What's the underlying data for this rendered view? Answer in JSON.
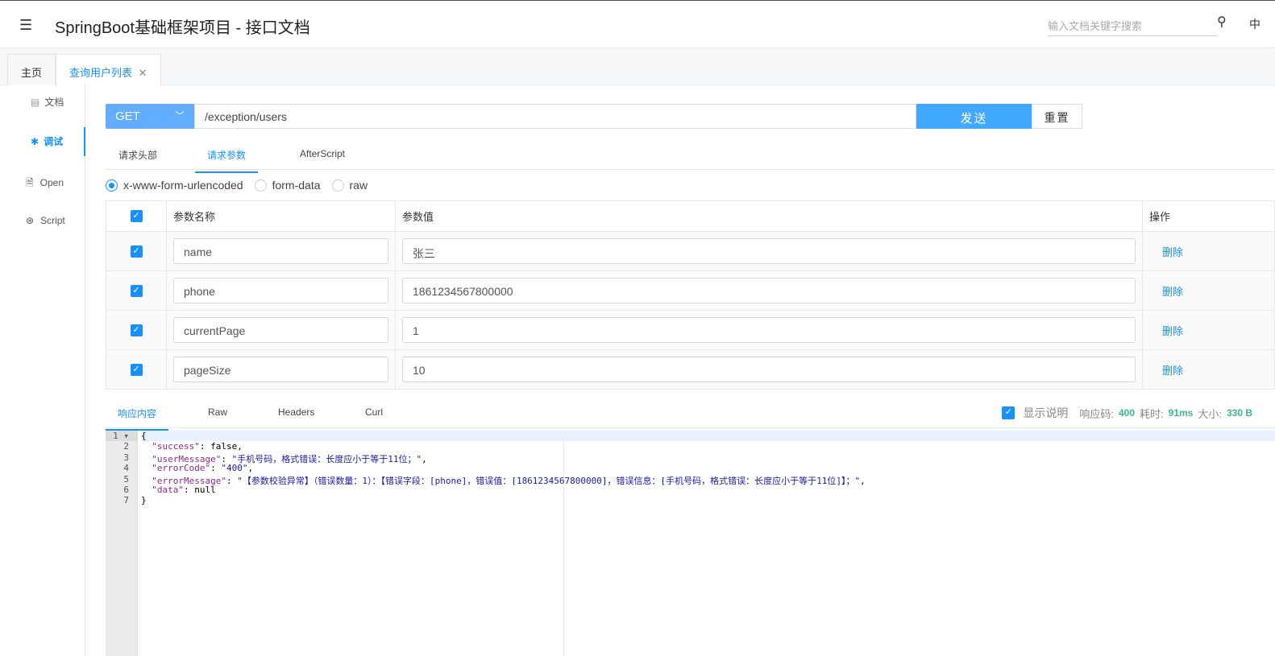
{
  "header": {
    "title": "SpringBoot基础框架项目 - 接口文档",
    "search_placeholder": "输入文档关键字搜索",
    "lang": "中"
  },
  "tabs": [
    {
      "label": "主页"
    },
    {
      "label": "查询用户列表",
      "active": true
    }
  ],
  "sidebar": {
    "items": [
      {
        "label": "文档",
        "icon": "document-icon"
      },
      {
        "label": "调试",
        "icon": "bug-icon",
        "active": true
      },
      {
        "label": "Open",
        "icon": "file-icon"
      },
      {
        "label": "Script",
        "icon": "code-icon"
      }
    ]
  },
  "request": {
    "method": "GET",
    "url": "/exception/users",
    "send": "发送",
    "reset": "重置"
  },
  "request_tabs": [
    {
      "label": "请求头部"
    },
    {
      "label": "请求参数",
      "active": true
    },
    {
      "label": "AfterScript"
    }
  ],
  "body_types": [
    {
      "label": "x-www-form-urlencoded",
      "selected": true
    },
    {
      "label": "form-data"
    },
    {
      "label": "raw"
    }
  ],
  "params": {
    "headers": {
      "name": "参数名称",
      "value": "参数值",
      "action": "操作"
    },
    "rows": [
      {
        "name": "name",
        "value": "张三",
        "action": "删除",
        "checked": true
      },
      {
        "name": "phone",
        "value": "1861234567800000",
        "action": "删除",
        "checked": true
      },
      {
        "name": "currentPage",
        "value": "1",
        "action": "删除",
        "checked": true
      },
      {
        "name": "pageSize",
        "value": "10",
        "action": "删除",
        "checked": true
      }
    ]
  },
  "response_tabs": [
    {
      "label": "响应内容",
      "active": true
    },
    {
      "label": "Raw"
    },
    {
      "label": "Headers"
    },
    {
      "label": "Curl"
    }
  ],
  "status": {
    "show_desc": "显示说明",
    "code_label": "响应码:",
    "code": "400",
    "time_label": "耗时:",
    "time": "91ms",
    "size_label": "大小:",
    "size": "330 B"
  },
  "response_lines": [
    "{",
    "  \"success\": false,",
    "  \"userMessage\": \"手机号码，格式错误：长度应小于等于11位；\",",
    "  \"errorCode\": \"400\",",
    "  \"errorMessage\": \"【参数校验异常】（错误数量：1）：【错误字段：[phone]，错误值：[1861234567800000]，错误信息：[手机号码，格式错误：长度应小于等于11位]】；\",",
    "  \"data\": null",
    "}"
  ],
  "colors": {
    "accent": "#1890ff",
    "success": "#3bb98a"
  }
}
